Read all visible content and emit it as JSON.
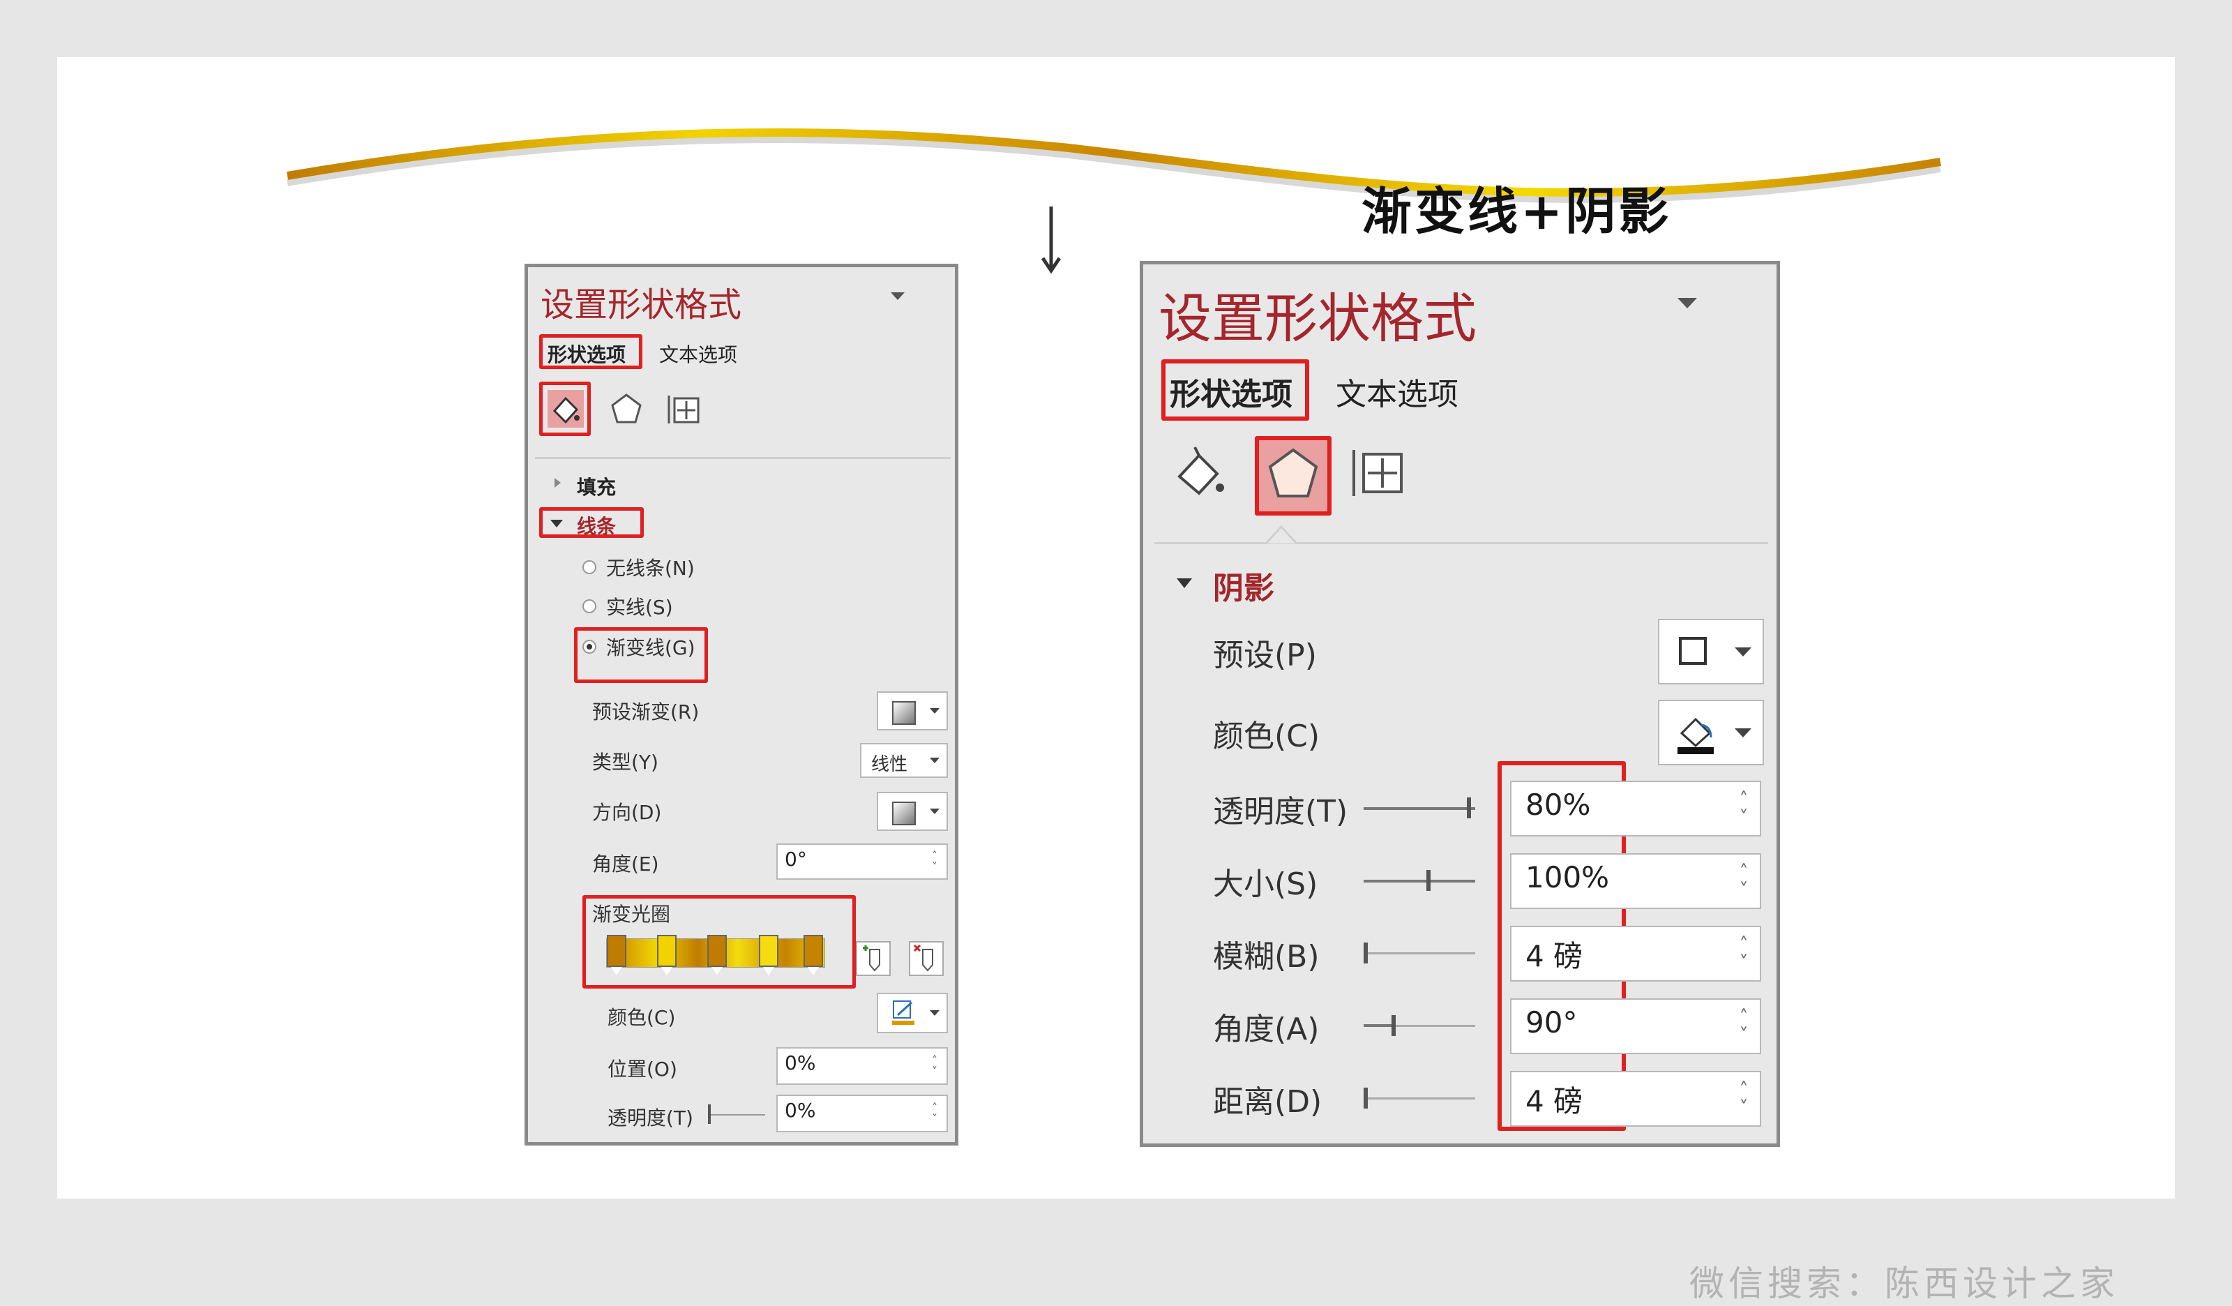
{
  "headline": "渐变线+阴影",
  "watermark": "微信搜索：陈西设计之家",
  "colors": {
    "accent_red": "#a4262c",
    "highlight_red": "#e02020",
    "gold": "#d49a00"
  },
  "left_panel": {
    "title": "设置形状格式",
    "tabs": [
      "形状选项",
      "文本选项"
    ],
    "icons": [
      "fill-line-icon",
      "effects-pentagon-icon",
      "size-properties-icon"
    ],
    "section_fill": "填充",
    "section_line": "线条",
    "radios": [
      "无线条(N)",
      "实线(S)",
      "渐变线(G)"
    ],
    "selected_radio": "渐变线(G)",
    "preset_gradient_label": "预设渐变(R)",
    "type_label": "类型(Y)",
    "type_value": "线性",
    "direction_label": "方向(D)",
    "angle_label": "角度(E)",
    "angle_value": "0°",
    "gradient_stops_label": "渐变光圈",
    "color_label": "颜色(C)",
    "position_label": "位置(O)",
    "position_value": "0%",
    "transparency_label": "透明度(T)",
    "transparency_value": "0%"
  },
  "right_panel": {
    "title": "设置形状格式",
    "tabs": [
      "形状选项",
      "文本选项"
    ],
    "icons": [
      "fill-line-icon",
      "effects-pentagon-icon",
      "size-properties-icon"
    ],
    "section_shadow": "阴影",
    "preset_label": "预设(P)",
    "color_label": "颜色(C)",
    "rows": [
      {
        "label": "透明度(T)",
        "value": "80%"
      },
      {
        "label": "大小(S)",
        "value": "100%"
      },
      {
        "label": "模糊(B)",
        "value": "4 磅"
      },
      {
        "label": "角度(A)",
        "value": "90°"
      },
      {
        "label": "距离(D)",
        "value": "4 磅"
      }
    ]
  }
}
